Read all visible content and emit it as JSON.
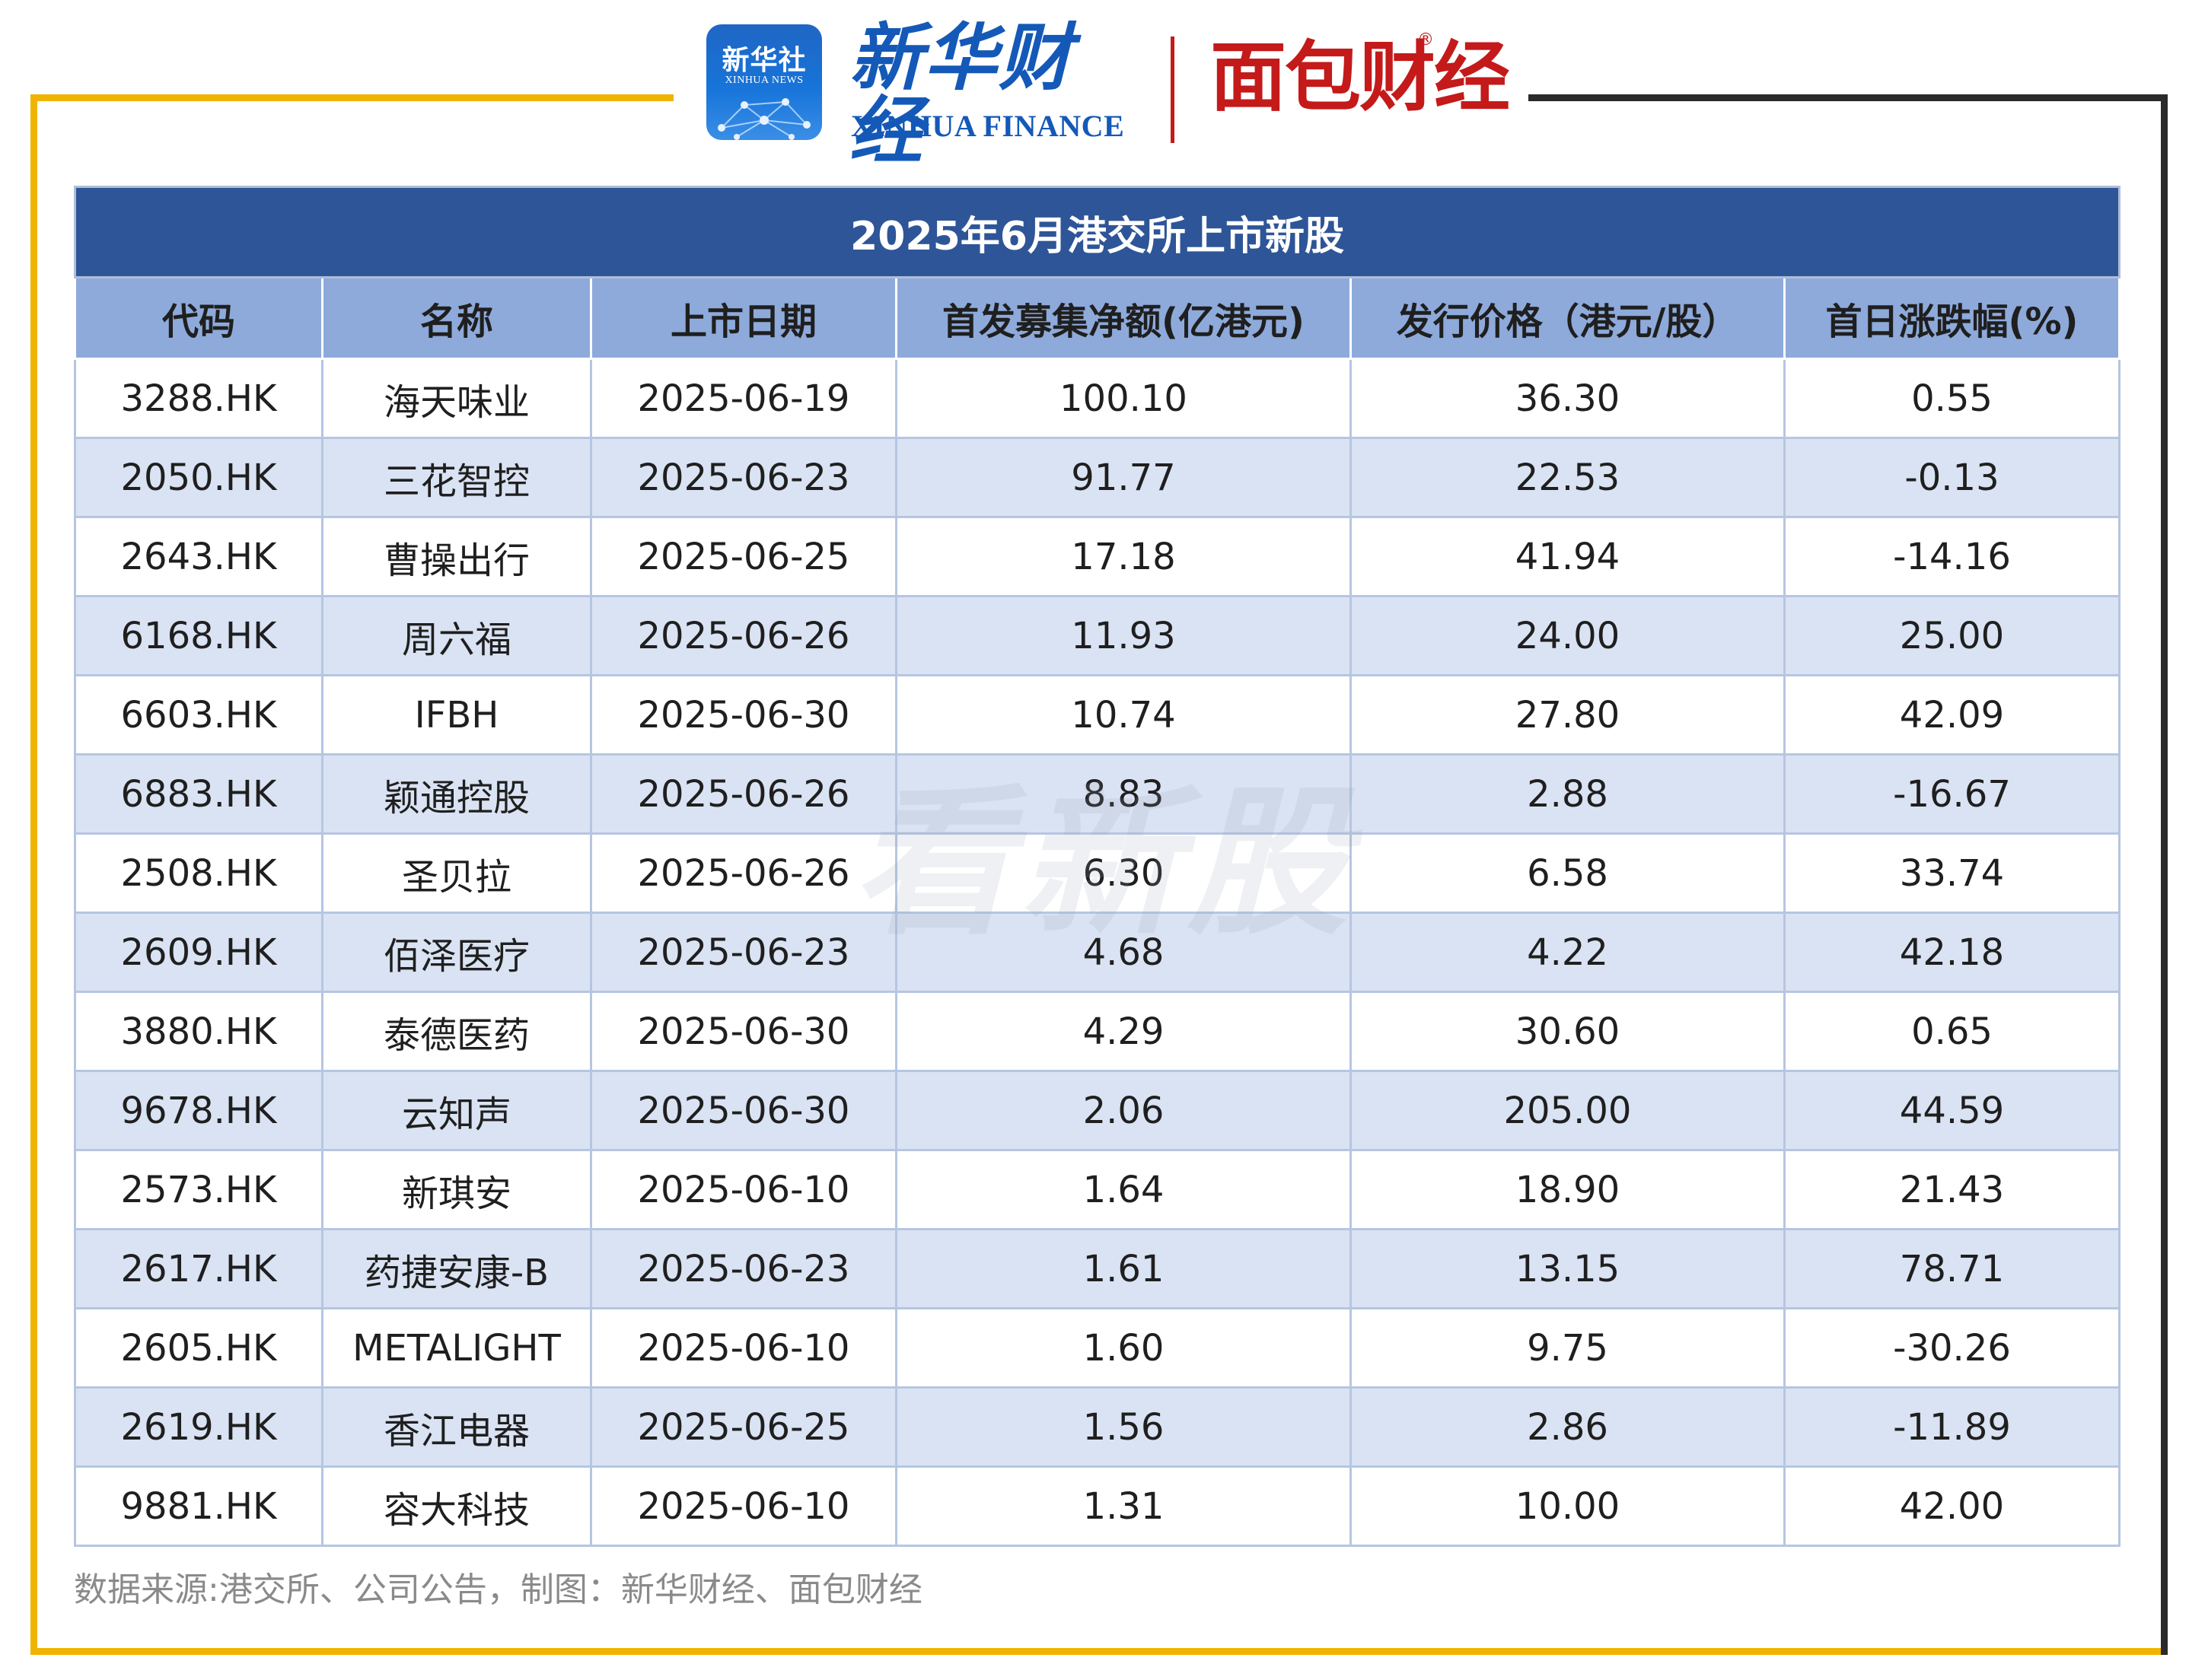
{
  "header": {
    "xinhua_badge_title": "新华社",
    "xinhua_badge_sub": "XINHUA NEWS",
    "xinhua_finance_cn": "新华财经",
    "xinhua_finance_en": "XINHUA FINANCE",
    "mianbao_logo": "面包财经",
    "registered_mark": "®"
  },
  "table": {
    "title": "2025年6月港交所上市新股",
    "columns": [
      "代码",
      "名称",
      "上市日期",
      "首发募集净额(亿港元)",
      "发行价格（港元/股）",
      "首日涨跌幅(%)"
    ],
    "rows": [
      [
        "3288.HK",
        "海天味业",
        "2025-06-19",
        "100.10",
        "36.30",
        "0.55"
      ],
      [
        "2050.HK",
        "三花智控",
        "2025-06-23",
        "91.77",
        "22.53",
        "-0.13"
      ],
      [
        "2643.HK",
        "曹操出行",
        "2025-06-25",
        "17.18",
        "41.94",
        "-14.16"
      ],
      [
        "6168.HK",
        "周六福",
        "2025-06-26",
        "11.93",
        "24.00",
        "25.00"
      ],
      [
        "6603.HK",
        "IFBH",
        "2025-06-30",
        "10.74",
        "27.80",
        "42.09"
      ],
      [
        "6883.HK",
        "颖通控股",
        "2025-06-26",
        "8.83",
        "2.88",
        "-16.67"
      ],
      [
        "2508.HK",
        "圣贝拉",
        "2025-06-26",
        "6.30",
        "6.58",
        "33.74"
      ],
      [
        "2609.HK",
        "佰泽医疗",
        "2025-06-23",
        "4.68",
        "4.22",
        "42.18"
      ],
      [
        "3880.HK",
        "泰德医药",
        "2025-06-30",
        "4.29",
        "30.60",
        "0.65"
      ],
      [
        "9678.HK",
        "云知声",
        "2025-06-30",
        "2.06",
        "205.00",
        "44.59"
      ],
      [
        "2573.HK",
        "新琪安",
        "2025-06-10",
        "1.64",
        "18.90",
        "21.43"
      ],
      [
        "2617.HK",
        "药捷安康-B",
        "2025-06-23",
        "1.61",
        "13.15",
        "78.71"
      ],
      [
        "2605.HK",
        "METALIGHT",
        "2025-06-10",
        "1.60",
        "9.75",
        "-30.26"
      ],
      [
        "2619.HK",
        "香江电器",
        "2025-06-25",
        "1.56",
        "2.86",
        "-11.89"
      ],
      [
        "9881.HK",
        "容大科技",
        "2025-06-10",
        "1.31",
        "10.00",
        "42.00"
      ]
    ]
  },
  "watermark": "看新股",
  "footer": {
    "source": "数据来源:港交所、公司公告，制图：新华财经、面包财经"
  },
  "colors": {
    "title_bg": "#2e5597",
    "header_bg": "#8eaadb",
    "stripe_bg": "#dae3f3",
    "frame_gold": "#f0b400",
    "frame_dark": "#2a2a2a",
    "xinhua_blue": "#1459b8",
    "mianbao_red": "#c41a1a"
  }
}
